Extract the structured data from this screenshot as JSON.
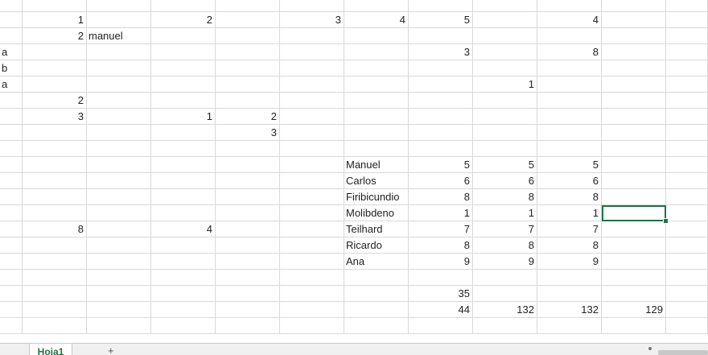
{
  "sheet": {
    "rows": [
      [],
      [
        {
          "c": 1,
          "v": "1"
        },
        {
          "c": 3,
          "v": "2"
        },
        {
          "c": 5,
          "v": "3"
        },
        {
          "c": 6,
          "v": "4"
        },
        {
          "c": 7,
          "v": "5"
        },
        {
          "c": 9,
          "v": "4"
        }
      ],
      [
        {
          "c": 1,
          "v": "2"
        },
        {
          "c": 2,
          "v": "manuel",
          "t": 1
        }
      ],
      [
        {
          "c": 0,
          "v": "a",
          "t": 1
        },
        {
          "c": 7,
          "v": "3"
        },
        {
          "c": 9,
          "v": "8"
        }
      ],
      [
        {
          "c": 0,
          "v": "b",
          "t": 1
        }
      ],
      [
        {
          "c": 0,
          "v": "a",
          "t": 1
        },
        {
          "c": 8,
          "v": "1"
        }
      ],
      [
        {
          "c": 1,
          "v": "2"
        }
      ],
      [
        {
          "c": 1,
          "v": "3"
        },
        {
          "c": 3,
          "v": "1"
        },
        {
          "c": 4,
          "v": "2"
        }
      ],
      [
        {
          "c": 4,
          "v": "3"
        }
      ],
      [],
      [
        {
          "c": 6,
          "v": "Manuel",
          "t": 1
        },
        {
          "c": 7,
          "v": "5"
        },
        {
          "c": 8,
          "v": "5"
        },
        {
          "c": 9,
          "v": "5"
        }
      ],
      [
        {
          "c": 6,
          "v": "Carlos",
          "t": 1
        },
        {
          "c": 7,
          "v": "6"
        },
        {
          "c": 8,
          "v": "6"
        },
        {
          "c": 9,
          "v": "6"
        }
      ],
      [
        {
          "c": 6,
          "v": "Firibicundio",
          "t": 1
        },
        {
          "c": 7,
          "v": "8"
        },
        {
          "c": 8,
          "v": "8"
        },
        {
          "c": 9,
          "v": "8"
        }
      ],
      [
        {
          "c": 6,
          "v": "Molibdeno",
          "t": 1
        },
        {
          "c": 7,
          "v": "1"
        },
        {
          "c": 8,
          "v": "1"
        },
        {
          "c": 9,
          "v": "1"
        }
      ],
      [
        {
          "c": 1,
          "v": "8"
        },
        {
          "c": 3,
          "v": "4"
        },
        {
          "c": 6,
          "v": "Teilhard",
          "t": 1
        },
        {
          "c": 7,
          "v": "7"
        },
        {
          "c": 8,
          "v": "7"
        },
        {
          "c": 9,
          "v": "7"
        }
      ],
      [
        {
          "c": 6,
          "v": "Ricardo",
          "t": 1
        },
        {
          "c": 7,
          "v": "8"
        },
        {
          "c": 8,
          "v": "8"
        },
        {
          "c": 9,
          "v": "8"
        }
      ],
      [
        {
          "c": 6,
          "v": "Ana",
          "t": 1
        },
        {
          "c": 7,
          "v": "9"
        },
        {
          "c": 8,
          "v": "9"
        },
        {
          "c": 9,
          "v": "9"
        }
      ],
      [],
      [
        {
          "c": 7,
          "v": "35"
        }
      ],
      [
        {
          "c": 7,
          "v": "44"
        },
        {
          "c": 8,
          "v": "132"
        },
        {
          "c": 9,
          "v": "132"
        },
        {
          "c": 10,
          "v": "129"
        }
      ],
      []
    ],
    "selected": {
      "row": 13,
      "col": 10
    }
  },
  "tabs": {
    "active_sheet": "Hoja1",
    "add_sheet_label": "+"
  },
  "colors": {
    "accent": "#217346",
    "gridline": "#d9d9d9"
  }
}
